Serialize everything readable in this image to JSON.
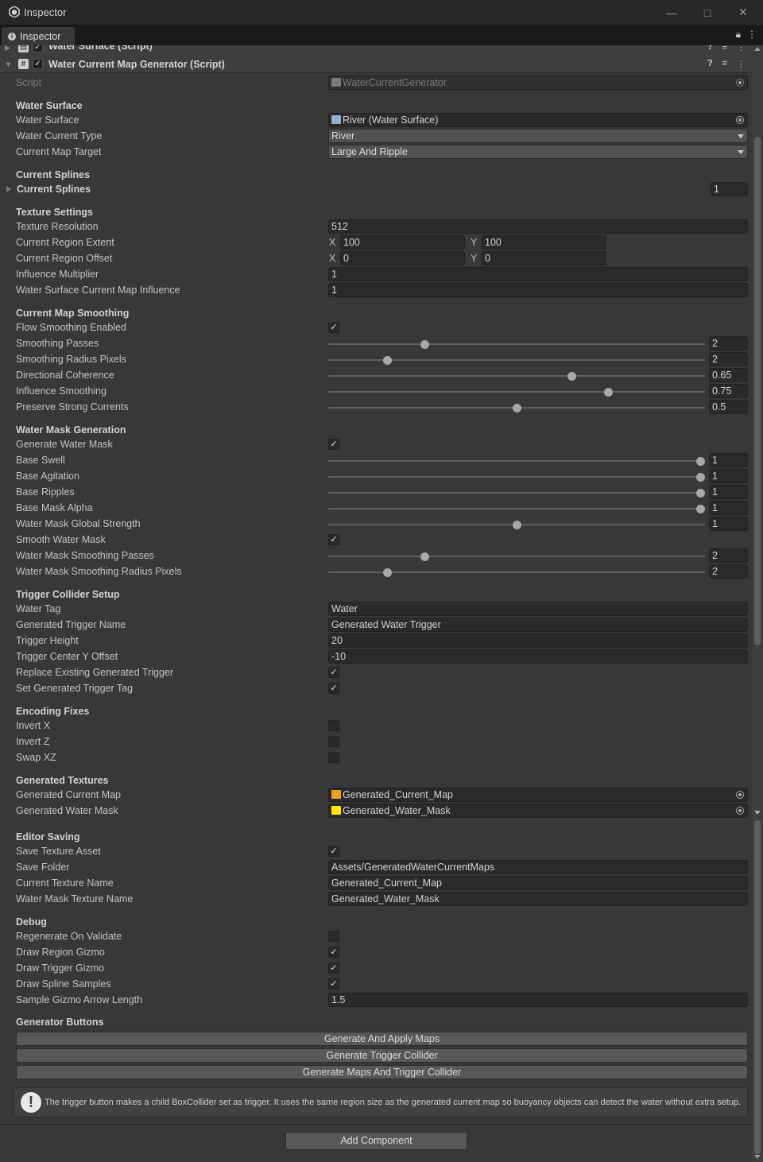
{
  "window": {
    "title": "Inspector"
  },
  "tab": {
    "label": "Inspector"
  },
  "components": {
    "prev": {
      "name": "Water Surface (Script)"
    },
    "main": {
      "name": "Water Current Map Generator (Script)"
    }
  },
  "script": {
    "label": "Script",
    "value": "WaterCurrentGenerator"
  },
  "sections": {
    "water_surface": "Water Surface",
    "current_splines": "Current Splines",
    "texture_settings": "Texture Settings",
    "current_map_smoothing": "Current Map Smoothing",
    "water_mask_generation": "Water Mask Generation",
    "trigger_collider_setup": "Trigger Collider Setup",
    "encoding_fixes": "Encoding Fixes",
    "generated_textures": "Generated Textures",
    "editor_saving": "Editor Saving",
    "debug": "Debug",
    "generator_buttons": "Generator Buttons"
  },
  "fields": {
    "water_surface": {
      "label": "Water Surface",
      "value": "River (Water Surface)"
    },
    "water_current_type": {
      "label": "Water Current Type",
      "value": "River"
    },
    "current_map_target": {
      "label": "Current Map Target",
      "value": "Large And Ripple"
    },
    "current_splines": {
      "label": "Current Splines",
      "value": "1"
    },
    "texture_resolution": {
      "label": "Texture Resolution",
      "value": "512"
    },
    "current_region_extent": {
      "label": "Current Region Extent",
      "x": "100",
      "y": "100"
    },
    "current_region_offset": {
      "label": "Current Region Offset",
      "x": "0",
      "y": "0"
    },
    "influence_multiplier": {
      "label": "Influence Multiplier",
      "value": "1"
    },
    "water_surface_current_map_influence": {
      "label": "Water Surface Current Map Influence",
      "value": "1"
    },
    "flow_smoothing_enabled": {
      "label": "Flow Smoothing Enabled",
      "checked": true
    },
    "smoothing_passes": {
      "label": "Smoothing Passes",
      "value": "2",
      "fraction": 0.25
    },
    "smoothing_radius_pixels": {
      "label": "Smoothing Radius Pixels",
      "value": "2",
      "fraction": 0.15
    },
    "directional_coherence": {
      "label": "Directional Coherence",
      "value": "0.65",
      "fraction": 0.65
    },
    "influence_smoothing": {
      "label": "Influence Smoothing",
      "value": "0.75",
      "fraction": 0.75
    },
    "preserve_strong_currents": {
      "label": "Preserve Strong Currents",
      "value": "0.5",
      "fraction": 0.5
    },
    "generate_water_mask": {
      "label": "Generate Water Mask",
      "checked": true
    },
    "base_swell": {
      "label": "Base Swell",
      "value": "1",
      "fraction": 1.0
    },
    "base_agitation": {
      "label": "Base Agitation",
      "value": "1",
      "fraction": 1.0
    },
    "base_ripples": {
      "label": "Base Ripples",
      "value": "1",
      "fraction": 1.0
    },
    "base_mask_alpha": {
      "label": "Base Mask Alpha",
      "value": "1",
      "fraction": 1.0
    },
    "water_mask_global_strength": {
      "label": "Water Mask Global Strength",
      "value": "1",
      "fraction": 0.5
    },
    "smooth_water_mask": {
      "label": "Smooth Water Mask",
      "checked": true
    },
    "water_mask_smoothing_passes": {
      "label": "Water Mask Smoothing Passes",
      "value": "2",
      "fraction": 0.25
    },
    "water_mask_smoothing_radius_pixels": {
      "label": "Water Mask Smoothing Radius Pixels",
      "value": "2",
      "fraction": 0.15
    },
    "water_tag": {
      "label": "Water Tag",
      "value": "Water"
    },
    "generated_trigger_name": {
      "label": "Generated Trigger Name",
      "value": "Generated Water Trigger"
    },
    "trigger_height": {
      "label": "Trigger Height",
      "value": "20"
    },
    "trigger_center_y_offset": {
      "label": "Trigger Center Y Offset",
      "value": "-10"
    },
    "replace_existing_generated_trigger": {
      "label": "Replace Existing Generated Trigger",
      "checked": true
    },
    "set_generated_trigger_tag": {
      "label": "Set Generated Trigger Tag",
      "checked": true
    },
    "invert_x": {
      "label": "Invert X",
      "checked": false
    },
    "invert_z": {
      "label": "Invert Z",
      "checked": false
    },
    "swap_xz": {
      "label": "Swap XZ",
      "checked": false
    },
    "generated_current_map": {
      "label": "Generated Current Map",
      "value": "Generated_Current_Map",
      "icon_color": "#f0a020"
    },
    "generated_water_mask": {
      "label": "Generated Water Mask",
      "value": "Generated_Water_Mask",
      "icon_color": "#ffe600"
    },
    "save_texture_asset": {
      "label": "Save Texture Asset",
      "checked": true
    },
    "save_folder": {
      "label": "Save Folder",
      "value": "Assets/GeneratedWaterCurrentMaps"
    },
    "current_texture_name": {
      "label": "Current Texture Name",
      "value": "Generated_Current_Map"
    },
    "water_mask_texture_name": {
      "label": "Water Mask Texture Name",
      "value": "Generated_Water_Mask"
    },
    "regenerate_on_validate": {
      "label": "Regenerate On Validate",
      "checked": false
    },
    "draw_region_gizmo": {
      "label": "Draw Region Gizmo",
      "checked": true
    },
    "draw_trigger_gizmo": {
      "label": "Draw Trigger Gizmo",
      "checked": true
    },
    "draw_spline_samples": {
      "label": "Draw Spline Samples",
      "checked": true
    },
    "sample_gizmo_arrow_length": {
      "label": "Sample Gizmo Arrow Length",
      "value": "1.5"
    }
  },
  "buttons": {
    "generate_apply_maps": "Generate And Apply Maps",
    "generate_trigger_collider": "Generate Trigger Collider",
    "generate_maps_and_trigger": "Generate Maps And Trigger Collider",
    "add_component": "Add Component"
  },
  "help": {
    "text": "The trigger button makes a child BoxCollider set as trigger. It uses the same region size as the generated current map so buoyancy objects can detect the water without extra setup."
  },
  "axis": {
    "x": "X",
    "y": "Y"
  },
  "colors": {
    "panel": "#383838",
    "field": "#2a2a2a",
    "button": "#585858"
  }
}
